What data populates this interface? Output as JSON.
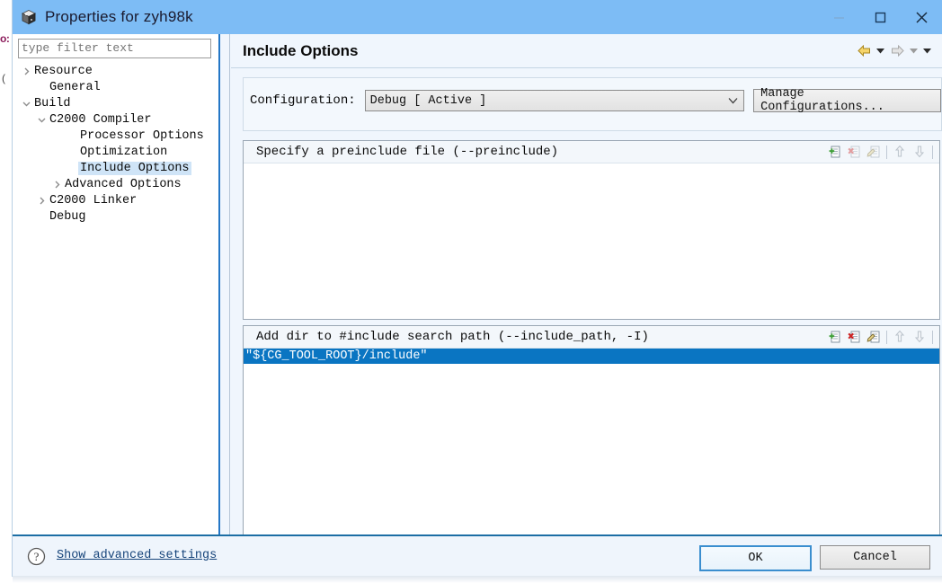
{
  "background": {
    "left_text_1": "o:",
    "left_text_2": "("
  },
  "window": {
    "title": "Properties for zyh98k",
    "icon": "cube-icon",
    "controls": {
      "minimize": "minimize-icon",
      "maximize": "maximize-icon",
      "close": "close-icon"
    }
  },
  "sidebar": {
    "filter_placeholder": "type filter text",
    "filter_value": "",
    "items": [
      {
        "label": "Resource",
        "indent": 0,
        "arrow": "collapsed",
        "selected": false
      },
      {
        "label": "General",
        "indent": 1,
        "arrow": "none",
        "selected": false
      },
      {
        "label": "Build",
        "indent": 0,
        "arrow": "expanded",
        "selected": false
      },
      {
        "label": "C2000 Compiler",
        "indent": 1,
        "arrow": "expanded",
        "selected": false
      },
      {
        "label": "Processor Options",
        "indent": 3,
        "arrow": "none",
        "selected": false
      },
      {
        "label": "Optimization",
        "indent": 3,
        "arrow": "none",
        "selected": false
      },
      {
        "label": "Include Options",
        "indent": 3,
        "arrow": "none",
        "selected": true
      },
      {
        "label": "Advanced Options",
        "indent": 2,
        "arrow": "collapsed",
        "selected": false
      },
      {
        "label": "C2000 Linker",
        "indent": 1,
        "arrow": "collapsed",
        "selected": false
      },
      {
        "label": "Debug",
        "indent": 1,
        "arrow": "none",
        "selected": false
      }
    ]
  },
  "page": {
    "title": "Include Options",
    "nav": {
      "back_icon": "back-arrow-icon",
      "back_enabled": true,
      "forward_icon": "forward-arrow-icon",
      "forward_enabled": false,
      "caret_icon": "caret-down-icon"
    }
  },
  "configuration": {
    "label": "Configuration:",
    "selected": "Debug  [ Active ]",
    "options": [
      "Debug  [ Active ]"
    ],
    "manage_button": "Manage Configurations..."
  },
  "sections": [
    {
      "id": "preinclude",
      "header": "Specify a preinclude file (--preinclude)",
      "rows": [],
      "tools": [
        {
          "name": "add-icon",
          "enabled": true
        },
        {
          "name": "delete-icon",
          "enabled": false
        },
        {
          "name": "edit-icon",
          "enabled": false
        },
        {
          "name": "move-up-icon",
          "enabled": false
        },
        {
          "name": "move-down-icon",
          "enabled": false
        }
      ]
    },
    {
      "id": "includepath",
      "header": "Add dir to #include search path (--include_path, -I)",
      "rows": [
        {
          "value": "\"${CG_TOOL_ROOT}/include\"",
          "selected": true
        }
      ],
      "tools": [
        {
          "name": "add-icon",
          "enabled": true
        },
        {
          "name": "delete-icon",
          "enabled": true
        },
        {
          "name": "edit-icon",
          "enabled": true
        },
        {
          "name": "move-up-icon",
          "enabled": false
        },
        {
          "name": "move-down-icon",
          "enabled": false
        }
      ]
    }
  ],
  "footer": {
    "help_icon": "help-question-icon",
    "advanced_link": "Show advanced settings",
    "ok_label": "OK",
    "cancel_label": "Cancel"
  },
  "colors": {
    "titlebar": "#7dbcf5",
    "selection_blue": "#0a75c2",
    "tree_selection": "#cfe4f7",
    "sash": "#2477c6",
    "footer_rule": "#1c6ea4",
    "link": "#16447a"
  }
}
